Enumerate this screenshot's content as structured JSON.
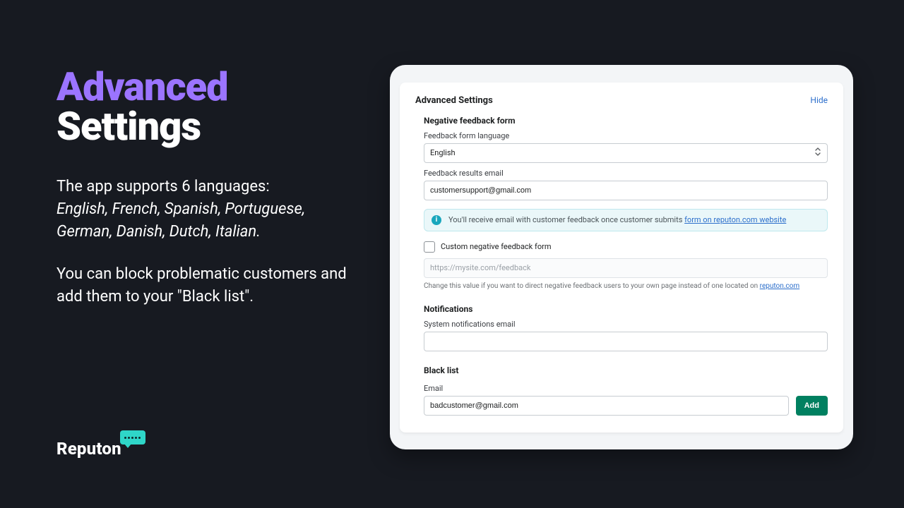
{
  "hero": {
    "title_line1": "Advanced",
    "title_line2": "Settings",
    "para1_lead": "The app supports 6 languages: ",
    "para1_langs": "English, French, Spanish, Portuguese, German, Danish, Dutch, Italian.",
    "para2": "You can block problematic customers and add them to your \"Black list\"."
  },
  "brand": {
    "name": "Reputon"
  },
  "card": {
    "title": "Advanced Settings",
    "hide": "Hide",
    "negative": {
      "heading": "Negative feedback form",
      "language_label": "Feedback form language",
      "language_value": "English",
      "results_label": "Feedback results email",
      "results_value": "customersupport@gmail.com",
      "banner_text": "You'll receive email with customer feedback once customer submits ",
      "banner_link": "form on reputon.com website",
      "custom_checkbox_label": "Custom negative feedback form",
      "custom_placeholder": "https://mysite.com/feedback",
      "helper_text": "Change this value if you want to direct negative feedback users to your own page instead of one located on ",
      "helper_link": "reputon.com"
    },
    "notifications": {
      "heading": "Notifications",
      "system_label": "System notifications email",
      "system_value": ""
    },
    "blacklist": {
      "heading": "Black list",
      "email_label": "Email",
      "email_value": "badcustomer@gmail.com",
      "add_label": "Add"
    }
  }
}
